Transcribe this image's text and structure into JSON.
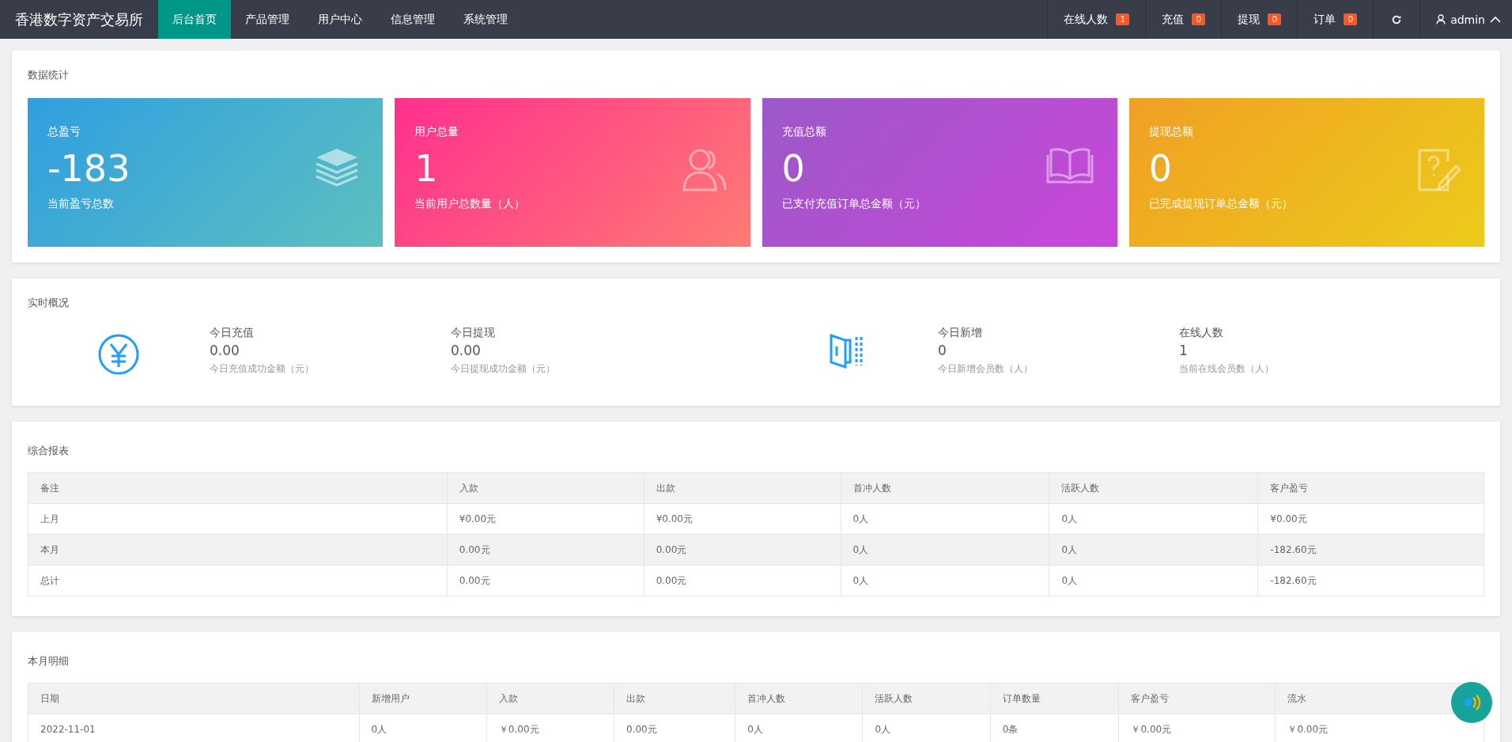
{
  "header": {
    "brand": "香港数字资产交易所",
    "nav": [
      {
        "label": "后台首页",
        "selected": true
      },
      {
        "label": "产品管理",
        "selected": false
      },
      {
        "label": "用户中心",
        "selected": false
      },
      {
        "label": "信息管理",
        "selected": false
      },
      {
        "label": "系统管理",
        "selected": false
      }
    ],
    "counters": [
      {
        "label": "在线人数",
        "badge": "1"
      },
      {
        "label": "充值",
        "badge": "0"
      },
      {
        "label": "提现",
        "badge": "0"
      },
      {
        "label": "订单",
        "badge": "0"
      }
    ],
    "user": "admin"
  },
  "stats": {
    "title": "数据统计",
    "cards": [
      {
        "label": "总盈亏",
        "value": "-183",
        "note": "当前盈亏总数"
      },
      {
        "label": "用户总量",
        "value": "1",
        "note": "当前用户总数量（人）"
      },
      {
        "label": "充值总额",
        "value": "0",
        "note": "已支付充值订单总金额（元）"
      },
      {
        "label": "提现总额",
        "value": "0",
        "note": "已完成提现订单总金额（元）"
      }
    ]
  },
  "realtime": {
    "title": "实时概况",
    "groups": [
      {
        "items": [
          {
            "label": "今日充值",
            "value": "0.00",
            "note": "今日充值成功金额（元）"
          },
          {
            "label": "今日提现",
            "value": "0.00",
            "note": "今日提现成功金额（元）"
          }
        ]
      },
      {
        "items": [
          {
            "label": "今日新增",
            "value": "0",
            "note": "今日新增会员数（人）"
          },
          {
            "label": "在线人数",
            "value": "1",
            "note": "当前在线会员数（人）"
          }
        ]
      }
    ]
  },
  "report": {
    "title": "综合报表",
    "columns": [
      "备注",
      "入款",
      "出款",
      "首冲人数",
      "活跃人数",
      "客户盈亏"
    ],
    "rows": [
      [
        "上月",
        "¥0.00元",
        "¥0.00元",
        "0人",
        "0人",
        "¥0.00元"
      ],
      [
        "本月",
        "0.00元",
        "0.00元",
        "0人",
        "0人",
        "-182.60元"
      ],
      [
        "总计",
        "0.00元",
        "0.00元",
        "0人",
        "0人",
        "-182.60元"
      ]
    ]
  },
  "monthly": {
    "title": "本月明细",
    "columns": [
      "日期",
      "新增用户",
      "入款",
      "出款",
      "首冲人数",
      "活跃人数",
      "订单数量",
      "客户盈亏",
      "流水"
    ],
    "rows": [
      [
        "2022-11-01",
        "0人",
        "￥0.00元",
        "0.00元",
        "0人",
        "0人",
        "0条",
        "￥0.00元",
        "￥0.00元"
      ]
    ]
  }
}
